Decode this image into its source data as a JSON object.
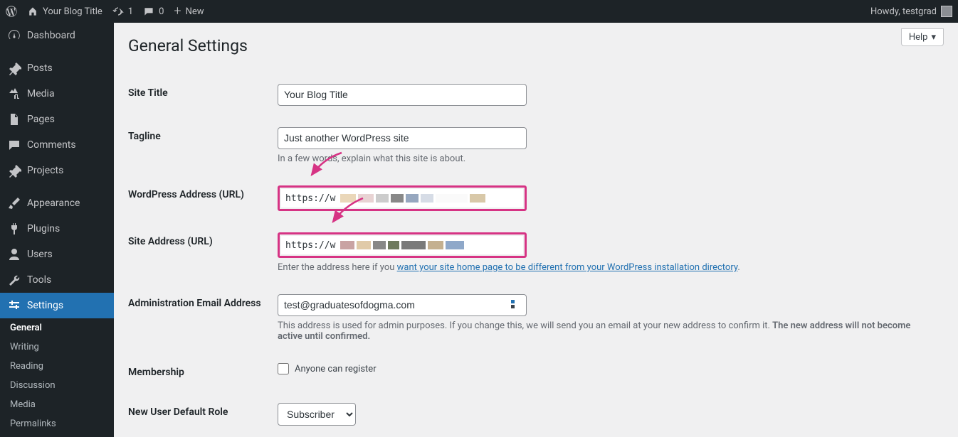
{
  "adminbar": {
    "site_title": "Your Blog Title",
    "updates_count": "1",
    "comments_count": "0",
    "new_label": "New",
    "howdy": "Howdy, testgrad"
  },
  "sidebar": {
    "items": [
      {
        "label": "Dashboard",
        "icon": "dashboard"
      },
      {
        "label": "Posts",
        "icon": "pin"
      },
      {
        "label": "Media",
        "icon": "media"
      },
      {
        "label": "Pages",
        "icon": "pages"
      },
      {
        "label": "Comments",
        "icon": "comment"
      },
      {
        "label": "Projects",
        "icon": "pin"
      },
      {
        "label": "Appearance",
        "icon": "brush"
      },
      {
        "label": "Plugins",
        "icon": "plug"
      },
      {
        "label": "Users",
        "icon": "user"
      },
      {
        "label": "Tools",
        "icon": "wrench"
      },
      {
        "label": "Settings",
        "icon": "sliders",
        "current": true
      }
    ],
    "submenu": [
      {
        "label": "General",
        "current": true
      },
      {
        "label": "Writing"
      },
      {
        "label": "Reading"
      },
      {
        "label": "Discussion"
      },
      {
        "label": "Media"
      },
      {
        "label": "Permalinks"
      }
    ]
  },
  "help_label": "Help",
  "page_title": "General Settings",
  "fields": {
    "site_title": {
      "label": "Site Title",
      "value": "Your Blog Title"
    },
    "tagline": {
      "label": "Tagline",
      "value": "Just another WordPress site",
      "desc": "In a few words, explain what this site is about."
    },
    "wp_url": {
      "label": "WordPress Address (URL)",
      "value_prefix": "https://w"
    },
    "site_url": {
      "label": "Site Address (URL)",
      "value_prefix": "https://w",
      "desc_pre": "Enter the address here if you ",
      "desc_link": "want your site home page to be different from your WordPress installation directory",
      "desc_post": "."
    },
    "admin_email": {
      "label": "Administration Email Address",
      "value": "test@graduatesofdogma.com",
      "desc_pre": "This address is used for admin purposes. If you change this, we will send you an email at your new address to confirm it. ",
      "desc_bold": "The new address will not become active until confirmed."
    },
    "membership": {
      "label": "Membership",
      "checkbox_label": "Anyone can register"
    },
    "default_role": {
      "label": "New User Default Role",
      "value": "Subscriber"
    }
  }
}
